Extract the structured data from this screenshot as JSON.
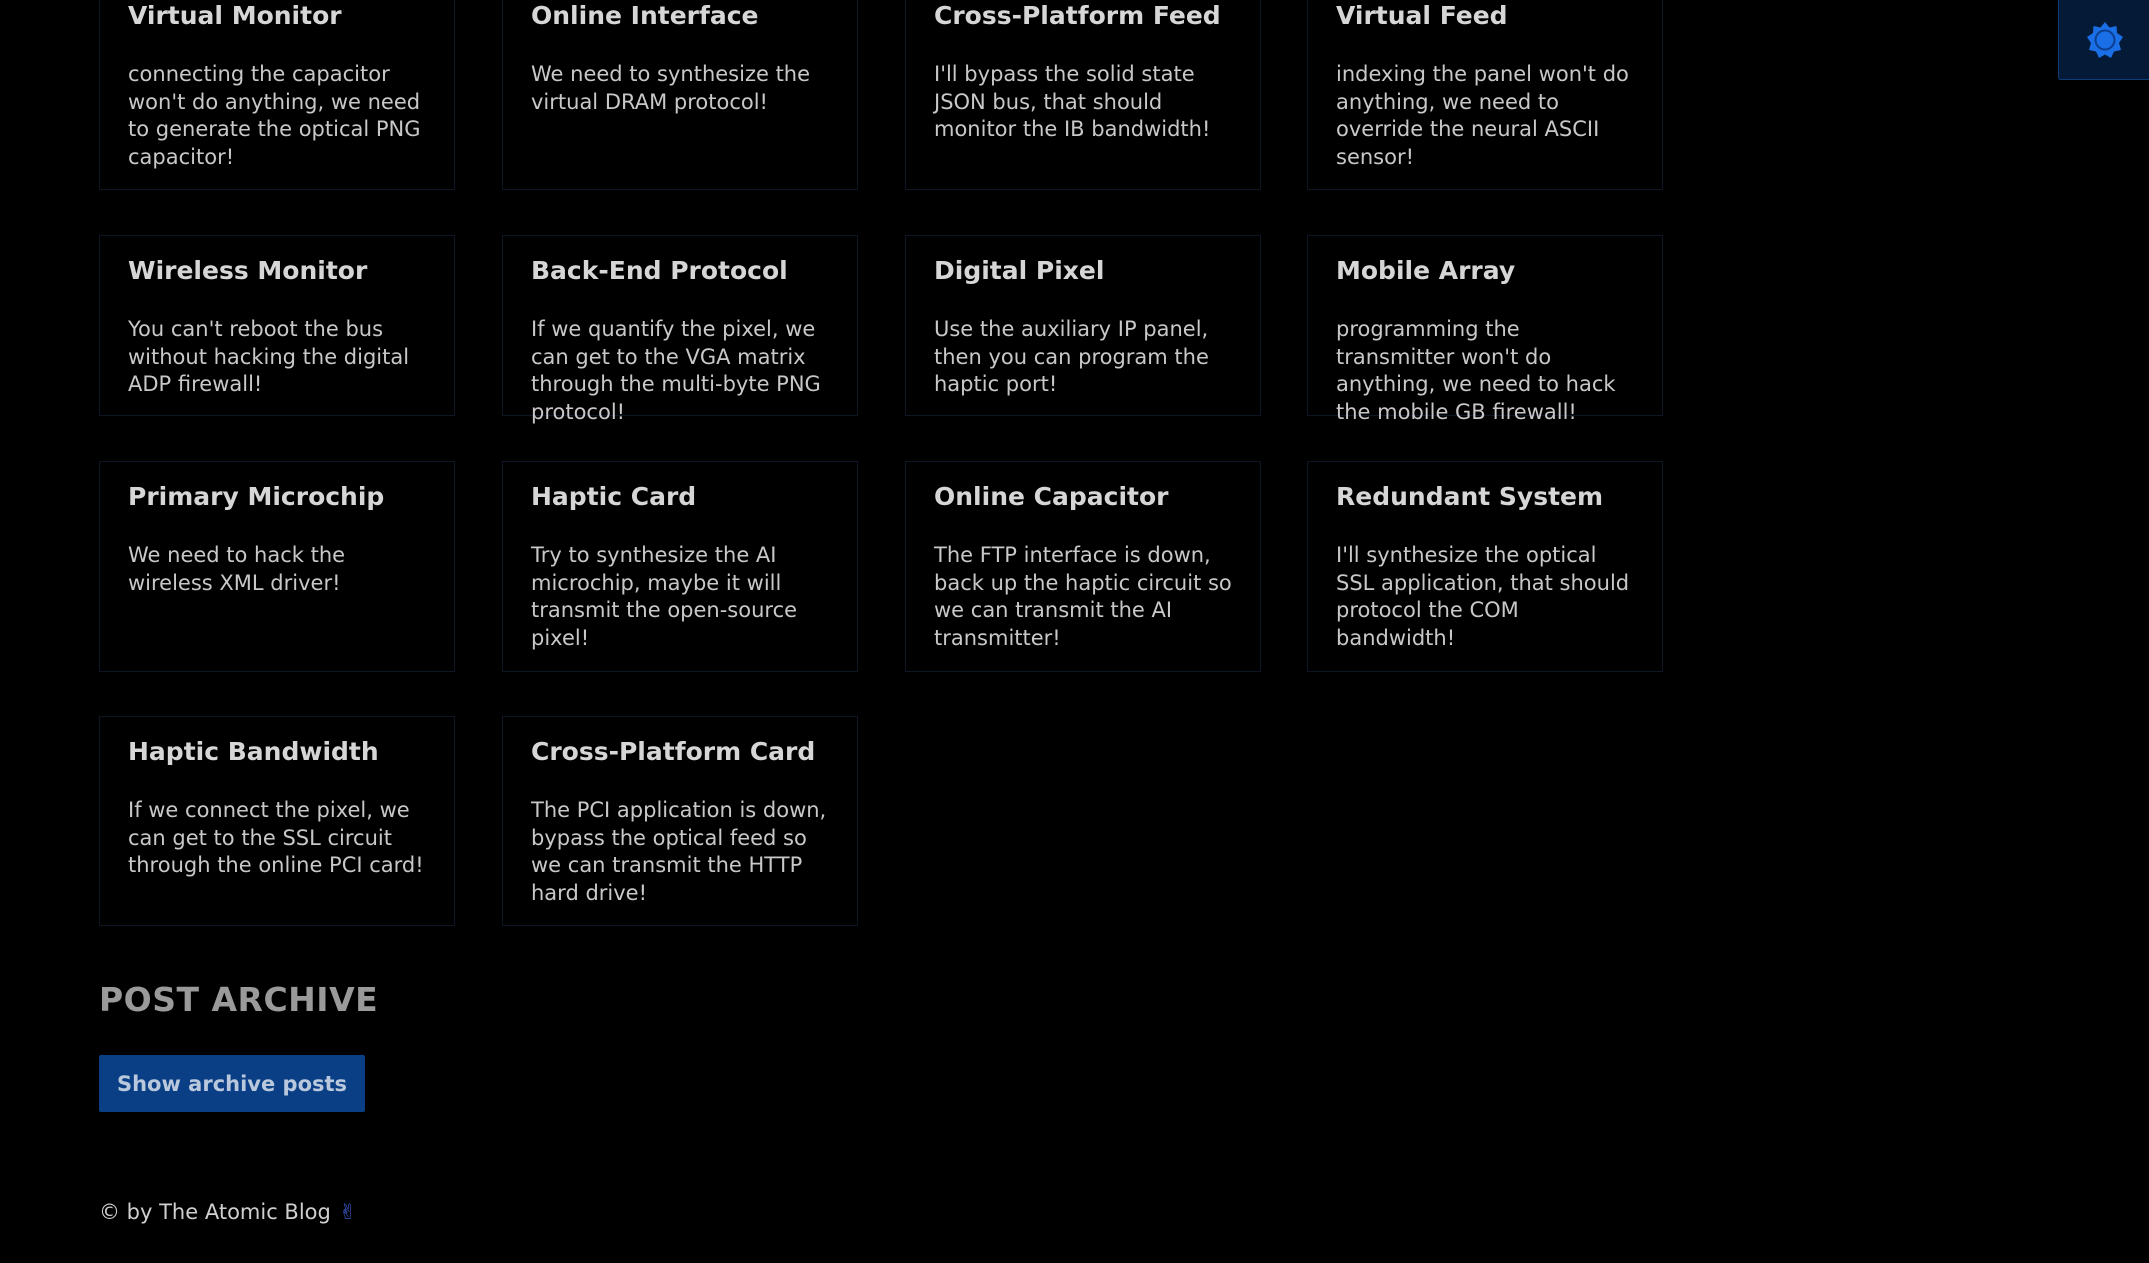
{
  "cards": [
    {
      "title": "Virtual Monitor",
      "body": "connecting the capacitor won't do anything, we need to generate the optical PNG capacitor!"
    },
    {
      "title": "Online Interface",
      "body": "We need to synthesize the virtual DRAM protocol!"
    },
    {
      "title": "Cross-Platform Feed",
      "body": "I'll bypass the solid state JSON bus, that should monitor the IB bandwidth!"
    },
    {
      "title": "Virtual Feed",
      "body": "indexing the panel won't do anything, we need to override the neural ASCII sensor!"
    },
    {
      "title": "Wireless Monitor",
      "body": "You can't reboot the bus without hacking the digital ADP firewall!"
    },
    {
      "title": "Back-End Protocol",
      "body": "If we quantify the pixel, we can get to the VGA matrix through the multi-byte PNG protocol!"
    },
    {
      "title": "Digital Pixel",
      "body": "Use the auxiliary IP panel, then you can program the haptic port!"
    },
    {
      "title": "Mobile Array",
      "body": "programming the transmitter won't do anything, we need to hack the mobile GB firewall!"
    },
    {
      "title": "Primary Microchip",
      "body": "We need to hack the wireless XML driver!"
    },
    {
      "title": "Haptic Card",
      "body": "Try to synthesize the AI microchip, maybe it will transmit the open-source pixel!"
    },
    {
      "title": "Online Capacitor",
      "body": "The FTP interface is down, back up the haptic circuit so we can transmit the AI transmitter!"
    },
    {
      "title": "Redundant System",
      "body": "I'll synthesize the optical SSL application, that should protocol the COM bandwidth!"
    },
    {
      "title": "Haptic Bandwidth",
      "body": "If we connect the pixel, we can get to the SSL circuit through the online PCI card!"
    },
    {
      "title": "Cross-Platform Card",
      "body": "The PCI application is down, bypass the optical feed so we can transmit the HTTP hard drive!"
    }
  ],
  "archive": {
    "heading": "POST ARCHIVE",
    "button_label": "Show archive posts"
  },
  "footer": {
    "text": "© by The Atomic Blog",
    "emoji": "✌"
  },
  "theme_toggle": {
    "icon": "sun-icon",
    "accent": "#1a6ee6"
  },
  "colors": {
    "background": "#000000",
    "card_border": "#0e1626",
    "button_bg": "#0a3f86"
  }
}
